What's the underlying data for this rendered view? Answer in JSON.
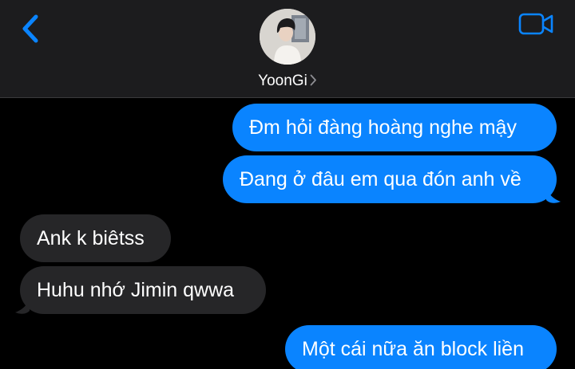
{
  "header": {
    "contact_name": "YoonGi",
    "back_icon": "chevron-left-icon",
    "video_icon": "video-camera-icon",
    "accent_color": "#0a84ff"
  },
  "messages": [
    {
      "direction": "outgoing",
      "text": "Đm hỏi đàng hoàng nghe mậy"
    },
    {
      "direction": "outgoing",
      "text": "Đang ở đâu em qua đón anh về"
    },
    {
      "direction": "incoming",
      "text": "Ank k biêtss"
    },
    {
      "direction": "incoming",
      "text": "Huhu nhớ Jimin qwwa"
    },
    {
      "direction": "outgoing",
      "text": "Một cái nữa ăn block liền"
    }
  ],
  "colors": {
    "background": "#000000",
    "header_background": "#1c1c1e",
    "outgoing_bubble": "#0a84ff",
    "incoming_bubble": "#262628"
  }
}
